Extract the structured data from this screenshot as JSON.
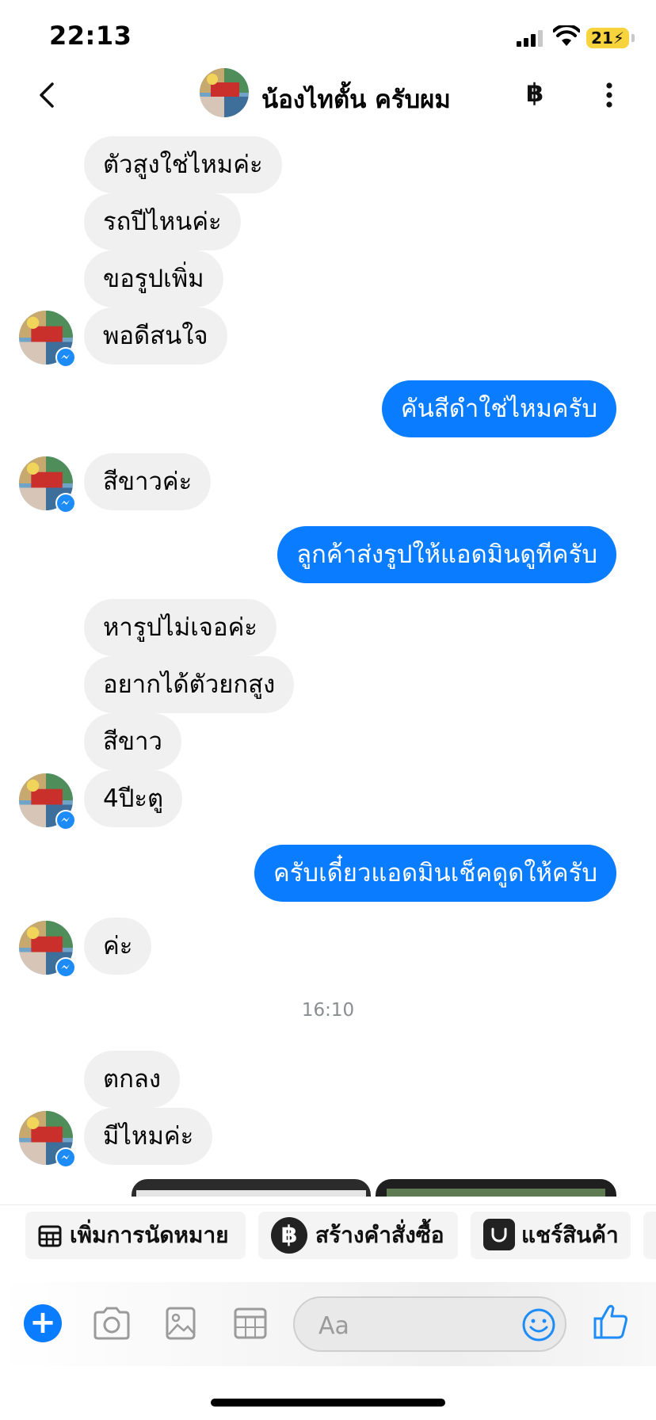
{
  "status_bar": {
    "time": "22:13",
    "battery": "21"
  },
  "header": {
    "title": "น้องไทตั้น ครับผม",
    "currency_symbol": "฿"
  },
  "messages": [
    {
      "from": "them",
      "text": "ตัวสูงใช่ไหมค่ะ"
    },
    {
      "from": "them",
      "text": "รถปีไหนค่ะ"
    },
    {
      "from": "them",
      "text": "ขอรูปเพิ่ม"
    },
    {
      "from": "them",
      "text": "พอดีสนใจ"
    },
    {
      "from": "me",
      "text": "คันสีดำใช่ไหมครับ"
    },
    {
      "from": "them",
      "text": "สีขาวค่ะ"
    },
    {
      "from": "me",
      "text": "ลูกค้าส่งรูปให้แอดมินดูทีครับ"
    },
    {
      "from": "them",
      "text": "หารูปไม่เจอค่ะ"
    },
    {
      "from": "them",
      "text": "อยากได้ตัวยกสูง"
    },
    {
      "from": "them",
      "text": "สีขาว"
    },
    {
      "from": "them",
      "text": "4ปีะตู"
    },
    {
      "from": "me",
      "text": "ครับเดี๋ยวแอดมินเช็คดูดให้ครับ"
    },
    {
      "from": "them",
      "text": "ค่ะ"
    },
    {
      "from": "them",
      "text": "ตกลง"
    },
    {
      "from": "them",
      "text": "มีไหมค่ะ"
    }
  ],
  "timestamp": "16:10",
  "quick_actions": [
    {
      "label": "เพิ่มการนัดหมาย",
      "icon": "calendar-grid-icon"
    },
    {
      "label": "สร้างคำสั่งซื้อ",
      "icon": "baht-icon"
    },
    {
      "label": "แชร์สินค้า",
      "icon": "shopping-bag-icon"
    }
  ],
  "composer": {
    "placeholder": "Aa"
  },
  "colors": {
    "accent": "#0a7cff",
    "incoming_bubble": "#f0f0f0"
  }
}
